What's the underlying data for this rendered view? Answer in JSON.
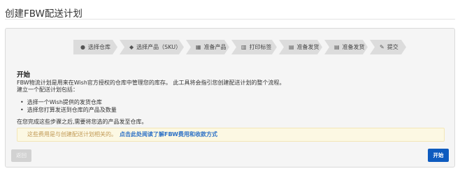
{
  "page": {
    "title": "创建FBW配送计划"
  },
  "steps": [
    {
      "label": "选择仓库",
      "icon": "globe-icon",
      "glyph": "●"
    },
    {
      "label": "选择产品（SKU）",
      "icon": "tag-icon",
      "glyph": "◆"
    },
    {
      "label": "准备产品",
      "icon": "grid-icon",
      "glyph": "▦"
    },
    {
      "label": "打印标签",
      "icon": "barcode-icon",
      "glyph": "▥"
    },
    {
      "label": "准备发货",
      "icon": "list-icon",
      "glyph": "▤"
    },
    {
      "label": "准备发货",
      "icon": "list-icon",
      "glyph": "▤"
    },
    {
      "label": "提交",
      "icon": "edit-icon",
      "glyph": "✎"
    }
  ],
  "content": {
    "heading": "开始",
    "intro_line1": "FBW物流计划是用来在Wish官方授权的仓库中管理您的库存。 此工具将会指引您创建配送计划的整个流程。",
    "intro_line2": "建立一个配送计划包括：",
    "bullets": [
      "选择一个Wish提供的发货仓库",
      "选择您打算发送到仓库的产品及数量"
    ],
    "closing": "在您完成这些步骤之后,需要将您选的产品发至仓库。"
  },
  "notice": {
    "text": "这些费用是与创建配送计划相关的。",
    "link": "点击此处阅读了解FBW费用和收款方式"
  },
  "buttons": {
    "back": "返回",
    "start": "开始"
  }
}
